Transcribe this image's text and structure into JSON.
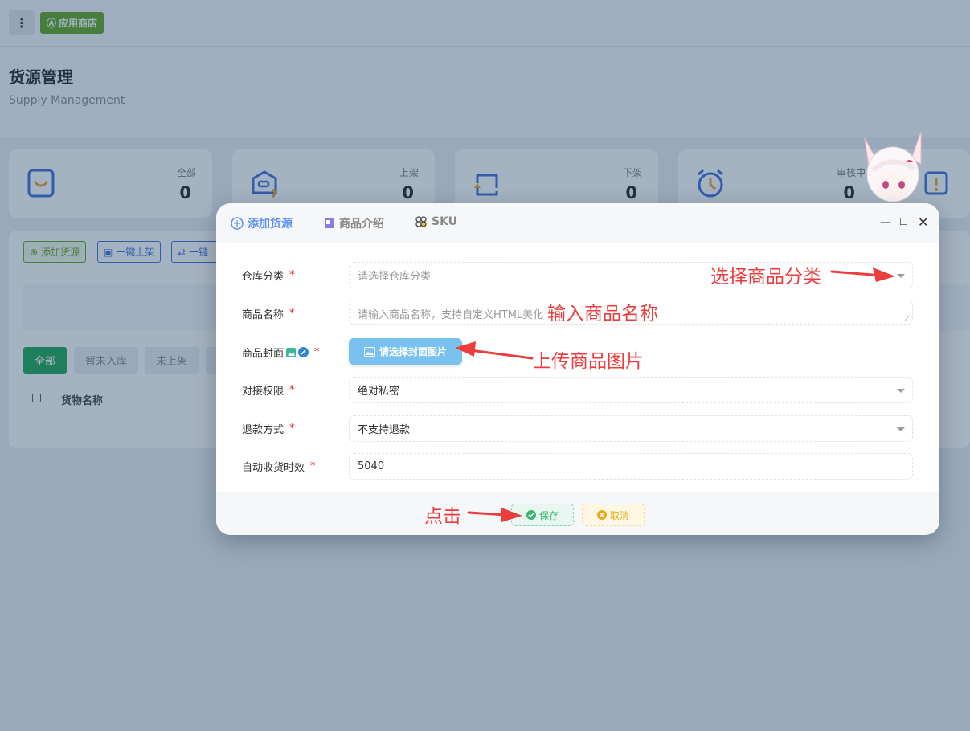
{
  "topbar": {
    "menu_icon": "more-vertical-icon",
    "store_label": "应用商店"
  },
  "header": {
    "title": "货源管理",
    "subtitle": "Supply Management"
  },
  "stats": [
    {
      "label": "全部",
      "value": "0"
    },
    {
      "label": "上架",
      "value": "0"
    },
    {
      "label": "下架",
      "value": "0"
    },
    {
      "label": "审核中",
      "value": "0"
    }
  ],
  "toolbar": {
    "add_label": "添加货源",
    "onshelf_label": "一键上架",
    "off_label": "一键"
  },
  "filter_tabs": [
    "全部",
    "暂未入库",
    "未上架"
  ],
  "table": {
    "col_name": "货物名称"
  },
  "modal": {
    "tabs": [
      "添加货源",
      "商品介绍",
      "SKU"
    ],
    "fields": {
      "category": {
        "label": "仓库分类",
        "placeholder": "请选择仓库分类"
      },
      "name": {
        "label": "商品名称",
        "placeholder": "请输入商品名称，支持自定义HTML美化"
      },
      "cover": {
        "label": "商品封面",
        "button": "请选择封面图片"
      },
      "permission": {
        "label": "对接权限",
        "value": "绝对私密"
      },
      "refund": {
        "label": "退款方式",
        "value": "不支持退款"
      },
      "auto_receive": {
        "label": "自动收货时效",
        "value": "5040"
      }
    },
    "footer": {
      "save": "保存",
      "cancel": "取消"
    }
  },
  "annotations": {
    "category": "选择商品分类",
    "name": "输入商品名称",
    "cover": "上传商品图片",
    "click": "点击"
  },
  "colors": {
    "accent": "#5b8ff9",
    "store_green": "#5fa21a",
    "filter_green": "#1aa44f",
    "annotation_red": "#ec3d3d"
  }
}
